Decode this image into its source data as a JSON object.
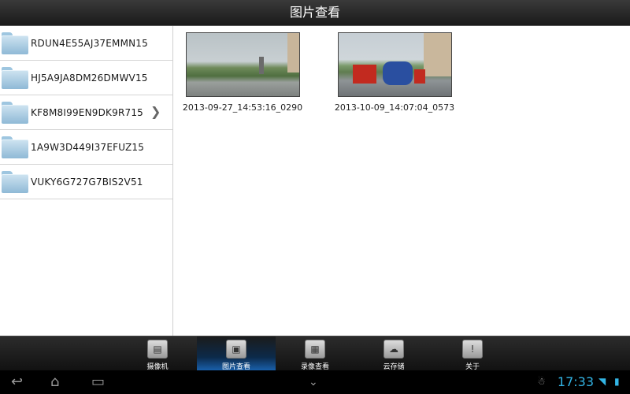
{
  "title": "图片查看",
  "folders": [
    {
      "label": "RDUN4E55AJ37EMMN15"
    },
    {
      "label": "HJ5A9JA8DM26DMWV15"
    },
    {
      "label": "KF8M8I99EN9DK9R715"
    },
    {
      "label": "1A9W3D449I37EFUZ15"
    },
    {
      "label": "VUKY6G727G7BIS2V51"
    }
  ],
  "selected_folder": "KF8M8I99EN9DK9R715",
  "thumbnails": [
    {
      "caption": "2013-09-27_14:53:16_0290"
    },
    {
      "caption": "2013-10-09_14:07:04_0573"
    }
  ],
  "tabs": [
    {
      "label": "摄像机",
      "icon": "camera-icon"
    },
    {
      "label": "图片查看",
      "icon": "picture-icon"
    },
    {
      "label": "录像查看",
      "icon": "video-icon"
    },
    {
      "label": "云存储",
      "icon": "cloud-icon"
    },
    {
      "label": "关于",
      "icon": "info-icon"
    }
  ],
  "active_tab": "图片查看",
  "status": {
    "time": "17:33"
  },
  "colors": {
    "accent": "#33b5e5",
    "tab_active": "#1a63b0"
  }
}
